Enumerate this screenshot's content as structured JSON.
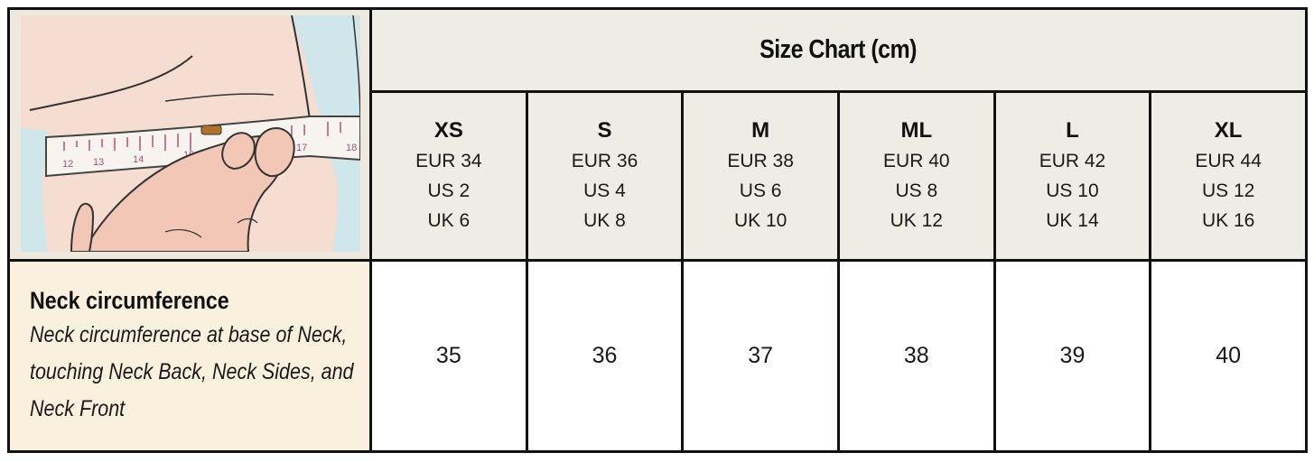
{
  "table": {
    "title": "Size Chart (cm)",
    "illustration": {
      "icon": "tape-measure-neck-illustration",
      "tape_ticks": [
        "12",
        "13",
        "14",
        "15",
        "17",
        "18"
      ]
    },
    "sizes": [
      {
        "name": "XS",
        "eur": "EUR 34",
        "us": "US 2",
        "uk": "UK 6"
      },
      {
        "name": "S",
        "eur": "EUR 36",
        "us": "US 4",
        "uk": "UK 8"
      },
      {
        "name": "M",
        "eur": "EUR 38",
        "us": "US 6",
        "uk": "UK 10"
      },
      {
        "name": "ML",
        "eur": "EUR 40",
        "us": "US 8",
        "uk": "UK 12"
      },
      {
        "name": "L",
        "eur": "EUR 42",
        "us": "US 10",
        "uk": "UK 14"
      },
      {
        "name": "XL",
        "eur": "EUR 44",
        "us": "US 12",
        "uk": "UK 16"
      }
    ],
    "measurement": {
      "label": "Neck circumference",
      "description": "Neck circumference at base of Neck, touching Neck Back, Neck Sides, and Neck Front",
      "values": [
        "35",
        "36",
        "37",
        "38",
        "39",
        "40"
      ]
    }
  },
  "colors": {
    "header_bg": "#ededE6",
    "label_bg": "#f9f0de",
    "border": "#111111"
  }
}
